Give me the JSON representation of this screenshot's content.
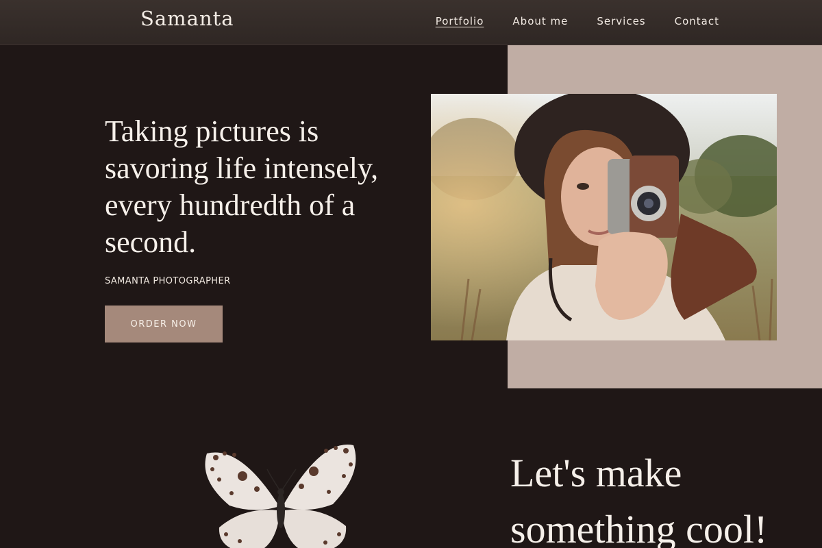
{
  "brand": {
    "logo": "Samanta"
  },
  "nav": {
    "items": [
      {
        "label": "Portfolio",
        "active": true
      },
      {
        "label": "About me",
        "active": false
      },
      {
        "label": "Services",
        "active": false
      },
      {
        "label": "Contact",
        "active": false
      }
    ]
  },
  "hero": {
    "headline": "Taking pictures is savoring life intensely, every hundredth of a second.",
    "subline": "SAMANTA PHOTOGRAPHER",
    "button_label": "ORDER NOW"
  },
  "cta": {
    "line1": "Let's make",
    "line2": "something cool!"
  },
  "colors": {
    "page_background": "#1f1716",
    "header_background": "#342b28",
    "accent_block": "#c0ada4",
    "button_background": "#a5897b",
    "text": "#f6f0ea"
  },
  "images": {
    "hero_photo": "woman-with-camera-photo",
    "decoration": "butterfly-illustration"
  }
}
